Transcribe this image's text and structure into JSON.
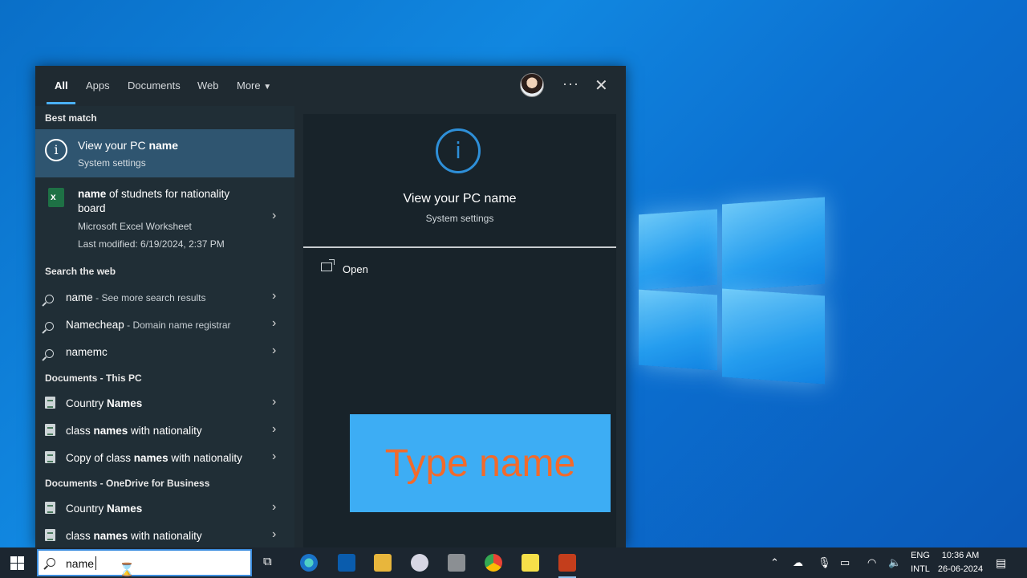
{
  "tabs": [
    {
      "label": "All"
    },
    {
      "label": "Apps"
    },
    {
      "label": "Documents"
    },
    {
      "label": "Web"
    },
    {
      "label": "More"
    }
  ],
  "sections": {
    "best_match": "Best match",
    "search_web": "Search the web",
    "docs_pc": "Documents - This PC",
    "docs_onedrive": "Documents - OneDrive for Business"
  },
  "best_match": {
    "title_prefix": "View your PC ",
    "title_bold": "name",
    "subtitle": "System settings"
  },
  "excel_result": {
    "title_bold": "name",
    "title_rest": " of studnets for nationality board",
    "type": "Microsoft Excel Worksheet",
    "modified": "Last modified: 6/19/2024, 2:37 PM"
  },
  "web_results": [
    {
      "bold": "name",
      "rest": " - See more search results"
    },
    {
      "bold": "Namecheap",
      "rest": " - Domain name registrar"
    },
    {
      "bold": "namemc",
      "rest": ""
    }
  ],
  "pc_docs": [
    {
      "pre": "Country ",
      "bold": "Names",
      "post": ""
    },
    {
      "pre": "class ",
      "bold": "names",
      "post": " with nationality"
    },
    {
      "pre": "Copy of class ",
      "bold": "names",
      "post": " with nationality"
    }
  ],
  "onedrive_docs": [
    {
      "pre": "Country ",
      "bold": "Names",
      "post": ""
    },
    {
      "pre": "class ",
      "bold": "names",
      "post": " with nationality"
    }
  ],
  "preview": {
    "title": "View your PC name",
    "subtitle": "System settings",
    "open_label": "Open"
  },
  "overlay_text": "Type name",
  "taskbar": {
    "search_value": "name",
    "lang_top": "ENG",
    "lang_bottom": "INTL",
    "time": "10:36 AM",
    "date": "26-06-2024"
  }
}
